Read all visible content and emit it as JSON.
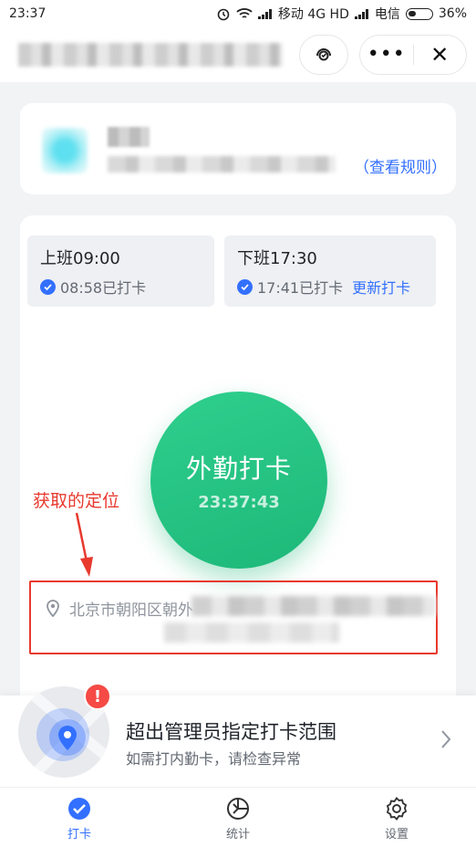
{
  "status_bar": {
    "time": "23:37",
    "carrier1": "移动 4G HD",
    "carrier2": "电信",
    "battery": "36%"
  },
  "header": {
    "title_obscured": true
  },
  "info_card": {
    "rules_link": "（查看规则）"
  },
  "shifts": {
    "on_duty": {
      "title": "上班09:00",
      "status": "08:58已打卡"
    },
    "off_duty": {
      "title": "下班17:30",
      "status": "17:41已打卡",
      "update_label": "更新打卡"
    }
  },
  "punch": {
    "label": "外勤打卡",
    "time": "23:37:43"
  },
  "annotation": {
    "label": "获取的定位",
    "color": "#e8392d"
  },
  "location": {
    "address_prefix": "北京市朝阳区朝外"
  },
  "banner": {
    "title": "超出管理员指定打卡范围",
    "subtitle": "如需打内勤卡，请检查异常",
    "alert": "!"
  },
  "tabbar": {
    "tabs": [
      {
        "label": "打卡",
        "icon": "check-circle-icon",
        "active": true
      },
      {
        "label": "统计",
        "icon": "pie-chart-icon",
        "active": false
      },
      {
        "label": "设置",
        "icon": "gear-icon",
        "active": false
      }
    ]
  },
  "colors": {
    "accent": "#3370ff",
    "punch_green": "#1db879",
    "alert_red": "#f54a45"
  }
}
